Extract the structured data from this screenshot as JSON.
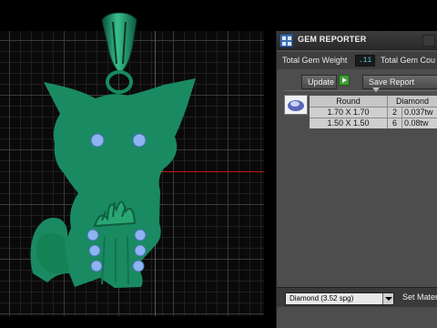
{
  "panel": {
    "title": "GEM REPORTER",
    "total_weight_label": "Total Gem Weight",
    "total_weight_value": ".11",
    "total_count_label": "Total Gem Cou",
    "update_label": "Update",
    "save_report_label": "Save Report"
  },
  "gem_table": {
    "columns": [
      "Round",
      "Diamond"
    ],
    "rows": [
      {
        "size": "1.70 X 1.70",
        "count": "2",
        "weight": "0.037tw"
      },
      {
        "size": "1.50 X 1.50",
        "count": "6",
        "weight": "0.08tw"
      }
    ]
  },
  "material": {
    "selected": "Diamond    (3.52 spg)",
    "set_label": "Set Mater"
  },
  "colors": {
    "model_green": "#1a8a62",
    "gem_blue": "#8db3f0",
    "axis_red": "#c01818",
    "panel_bg": "#4d4d4d"
  }
}
